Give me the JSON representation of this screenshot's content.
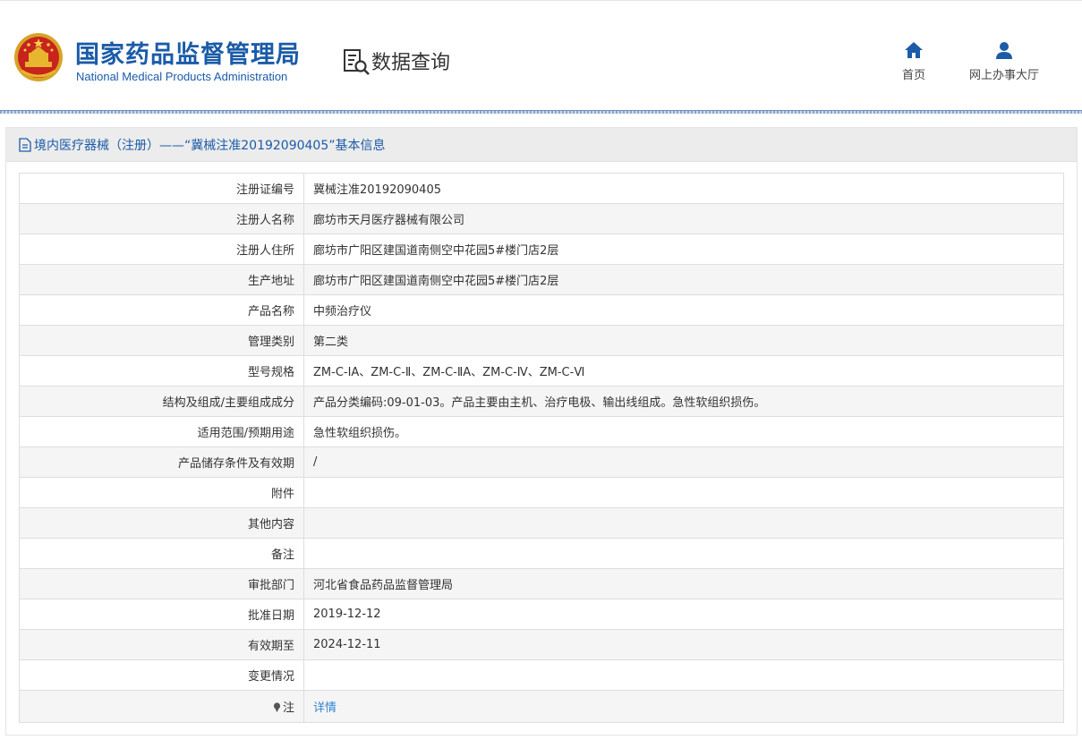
{
  "header": {
    "site_title": "国家药品监督管理局",
    "site_subtitle": "National Medical Products Administration",
    "section_title": "数据查询",
    "nav": [
      {
        "label": "首页",
        "icon": "home-icon"
      },
      {
        "label": "网上办事大厅",
        "icon": "user-icon"
      }
    ],
    "brand_color": "#1b5ba8"
  },
  "panel": {
    "title": "境内医疗器械（注册）——“冀械注准20192090405”基本信息",
    "icon": "document-icon"
  },
  "rows": [
    {
      "label": "注册证编号",
      "value": "冀械注准20192090405"
    },
    {
      "label": "注册人名称",
      "value": "廊坊市天月医疗器械有限公司"
    },
    {
      "label": "注册人住所",
      "value": "廊坊市广阳区建国道南侧空中花园5#楼门店2层"
    },
    {
      "label": "生产地址",
      "value": "廊坊市广阳区建国道南侧空中花园5#楼门店2层"
    },
    {
      "label": "产品名称",
      "value": "中频治疗仪"
    },
    {
      "label": "管理类别",
      "value": "第二类"
    },
    {
      "label": "型号规格",
      "value": "ZM-C-ⅠA、ZM-C-Ⅱ、ZM-C-ⅡA、ZM-C-Ⅳ、ZM-C-Ⅵ"
    },
    {
      "label": "结构及组成/主要组成成分",
      "value": "产品分类编码:09-01-03。产品主要由主机、治疗电极、输出线组成。急性软组织损伤。"
    },
    {
      "label": "适用范围/预期用途",
      "value": "急性软组织损伤。"
    },
    {
      "label": "产品储存条件及有效期",
      "value": "/"
    },
    {
      "label": "附件",
      "value": ""
    },
    {
      "label": "其他内容",
      "value": ""
    },
    {
      "label": "备注",
      "value": ""
    },
    {
      "label": "审批部门",
      "value": "河北省食品药品监督管理局"
    },
    {
      "label": "批准日期",
      "value": "2019-12-12"
    },
    {
      "label": "有效期至",
      "value": "2024-12-11"
    },
    {
      "label": "变更情况",
      "value": ""
    }
  ],
  "note_row": {
    "label": "注",
    "value": "详情",
    "icon": "pin-icon",
    "link_color": "#2f86d0"
  }
}
